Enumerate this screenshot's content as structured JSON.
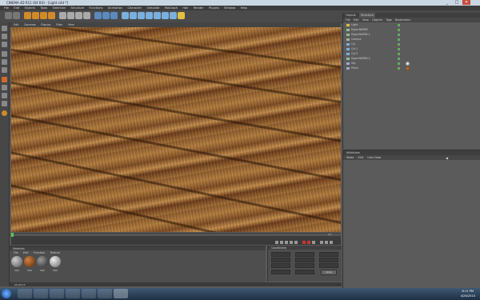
{
  "window": {
    "title": "CINEMA 4D R11 (64 Bit) - [Light.c4d *]",
    "controls": [
      "_",
      "□",
      "✕"
    ]
  },
  "menubar": [
    "File",
    "Edit",
    "Objects",
    "Tools",
    "Selection",
    "Structure",
    "Functions",
    "Animation",
    "Character",
    "Simulate",
    "MoGraph",
    "Hair",
    "Render",
    "Plugins",
    "Window",
    "Help"
  ],
  "viewport": {
    "menu": [
      "Edit",
      "Cameras",
      "Display",
      "Filter",
      "View"
    ]
  },
  "objects": {
    "tabs": [
      "Objects",
      "Structure"
    ],
    "menu": [
      "File",
      "Edit",
      "View",
      "Objects",
      "Tags",
      "Bookmarks"
    ],
    "rows": [
      "Light",
      "HyperNURBS",
      "HyperNURBS.1",
      "Camera",
      "Cyl",
      "Cyl.1",
      "Cyl.2",
      "HyperNURBS.2",
      "Sky",
      "Plane"
    ]
  },
  "attributes": {
    "title": "Attributes",
    "menu": [
      "Mode",
      "Edit",
      "User Data"
    ]
  },
  "materials": {
    "title": "Materials",
    "menu": [
      "File",
      "Edit",
      "Function",
      "Texture"
    ],
    "items": [
      "Mat",
      "Mat",
      "Mat",
      "Mat"
    ],
    "colors": [
      "#777777",
      "#8a4a20",
      "#5a5a5a",
      "#909090"
    ]
  },
  "coordinates": {
    "title": "Coordinates",
    "apply": "Apply"
  },
  "timeline": {
    "frame": "0 F"
  },
  "status": {
    "time": "00:00:13"
  },
  "taskbar": {
    "time": "8:11 PM",
    "date": "4/26/2010"
  }
}
